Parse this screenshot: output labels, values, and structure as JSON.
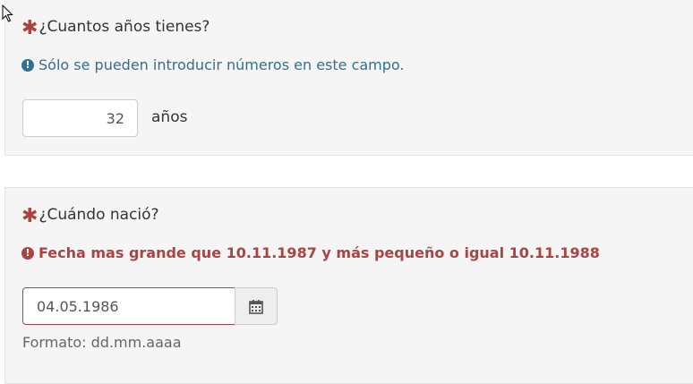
{
  "question_age": {
    "title": "¿Cuantos años tienes?",
    "tip": "Sólo se pueden introducir números en este campo.",
    "value": "32",
    "suffix": "años"
  },
  "question_birth": {
    "title": "¿Cuándo nació?",
    "error": "Fecha mas grande que 10.11.1987 y más pequeño o igual 10.11.1988",
    "value": "04.05.1986",
    "format_hint": "Formato: dd.mm.aaaa"
  },
  "icons": {
    "required": "asterisk-icon",
    "info": "exclamation-circle-icon",
    "error": "exclamation-circle-icon",
    "calendar": "calendar-icon",
    "cursor": "mouse-pointer-icon"
  },
  "colors": {
    "required_asterisk": "#a94442",
    "info_text": "#31708f",
    "error_text": "#a94442",
    "panel_background": "#f5f5f5"
  }
}
